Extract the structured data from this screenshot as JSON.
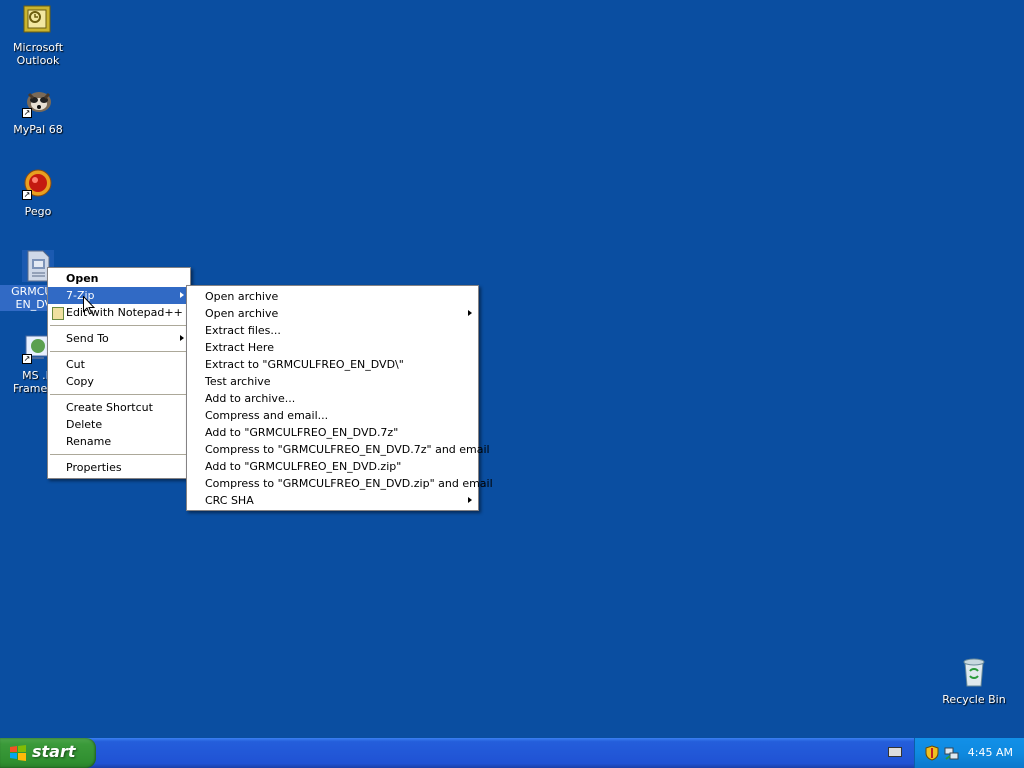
{
  "desktop": {
    "icons": [
      {
        "label": "Microsoft\nOutlook",
        "icon": "outlook-icon"
      },
      {
        "label": "MyPal 68",
        "icon": "mypal-icon"
      },
      {
        "label": "Pego",
        "icon": "pego-icon"
      },
      {
        "label": "GRMCULF\nEN_DVD",
        "icon": "iso-file-icon"
      },
      {
        "label": "MS .N\nFramewo",
        "icon": "dotnet-icon"
      },
      {
        "label": "Recycle Bin",
        "icon": "recycle-bin-icon"
      }
    ]
  },
  "context_menu": {
    "items": [
      {
        "label": "Open"
      },
      {
        "label": "7-Zip"
      },
      {
        "label": "Edit with Notepad++"
      },
      {
        "label": "Send To"
      },
      {
        "label": "Cut"
      },
      {
        "label": "Copy"
      },
      {
        "label": "Create Shortcut"
      },
      {
        "label": "Delete"
      },
      {
        "label": "Rename"
      },
      {
        "label": "Properties"
      }
    ]
  },
  "submenu": {
    "items": [
      {
        "label": "Open archive"
      },
      {
        "label": "Open archive"
      },
      {
        "label": "Extract files..."
      },
      {
        "label": "Extract Here"
      },
      {
        "label": "Extract to \"GRMCULFREO_EN_DVD\\\""
      },
      {
        "label": "Test archive"
      },
      {
        "label": "Add to archive..."
      },
      {
        "label": "Compress and email..."
      },
      {
        "label": "Add to \"GRMCULFREO_EN_DVD.7z\""
      },
      {
        "label": "Compress to \"GRMCULFREO_EN_DVD.7z\" and email"
      },
      {
        "label": "Add to \"GRMCULFREO_EN_DVD.zip\""
      },
      {
        "label": "Compress to \"GRMCULFREO_EN_DVD.zip\" and email"
      },
      {
        "label": "CRC SHA"
      }
    ]
  },
  "taskbar": {
    "start_label": "start",
    "clock": "4:45 AM"
  },
  "colors": {
    "desktop": "#0a4ea1",
    "highlight": "#316ac5",
    "start_green": "#3b9a3a"
  }
}
